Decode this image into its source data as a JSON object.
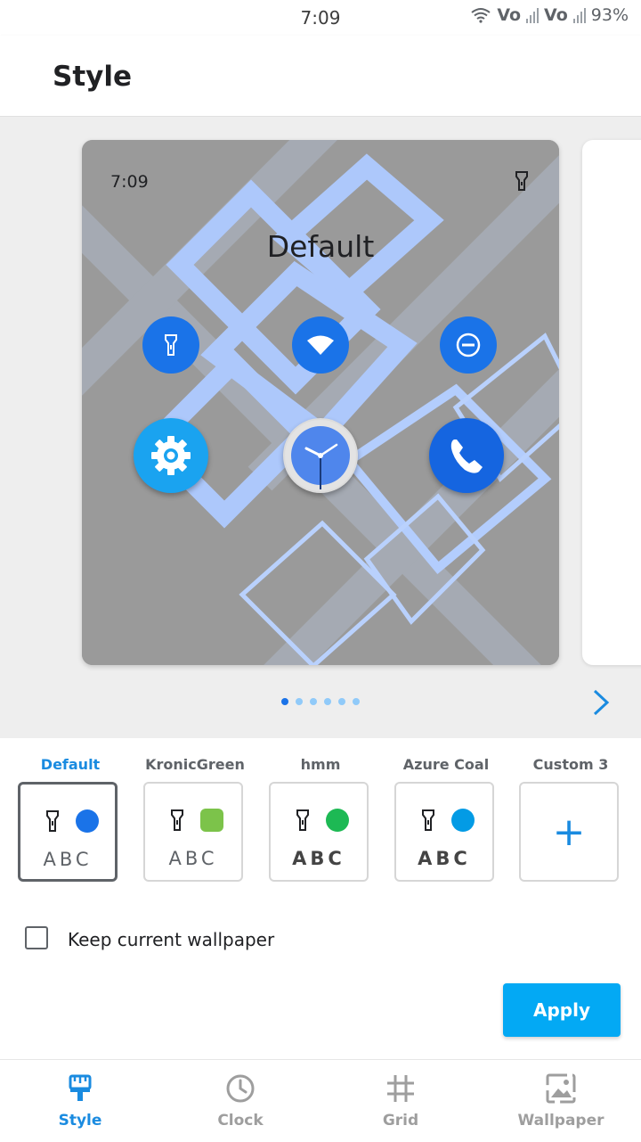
{
  "status_bar": {
    "time": "7:09",
    "network1": "Vo",
    "network2": "Vo",
    "battery": "93%"
  },
  "header": {
    "title": "Style"
  },
  "preview": {
    "time": "7:09",
    "title": "Default",
    "quick_settings": [
      "flashlight-icon",
      "wifi-icon",
      "do-not-disturb-icon"
    ],
    "apps": [
      "settings-icon",
      "clock-app-icon",
      "phone-icon"
    ],
    "page_count": 6,
    "active_page": 0,
    "accent_color": "#1a73e8"
  },
  "options": [
    {
      "label": "Default",
      "abc": "ABC",
      "shape": "circle",
      "color": "#1a73e8",
      "selected": true
    },
    {
      "label": "KronicGreen",
      "abc": "ABC",
      "shape": "rounded-square",
      "color": "#7cc34a",
      "selected": false
    },
    {
      "label": "hmm",
      "abc": "ABC",
      "shape": "circle",
      "color": "#1db954",
      "selected": false
    },
    {
      "label": "Azure Coal",
      "abc": "ABC",
      "shape": "circle",
      "color": "#039be5",
      "selected": false
    },
    {
      "label": "Custom 3",
      "add": "+"
    }
  ],
  "keep_wallpaper": {
    "label": "Keep current wallpaper",
    "checked": false
  },
  "apply_label": "Apply",
  "nav": [
    {
      "label": "Style",
      "icon": "brush-icon",
      "active": true
    },
    {
      "label": "Clock",
      "icon": "clock-icon",
      "active": false
    },
    {
      "label": "Grid",
      "icon": "grid-icon",
      "active": false
    },
    {
      "label": "Wallpaper",
      "icon": "wallpaper-icon",
      "active": false
    }
  ],
  "colors": {
    "accent": "#1a8be0",
    "apply_bg": "#03a9f4"
  }
}
